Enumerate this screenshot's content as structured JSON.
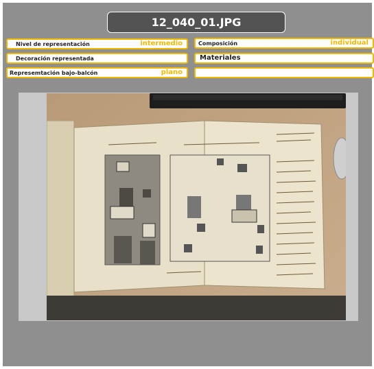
{
  "header": {
    "title": "12_040_01.JPG"
  },
  "fields": {
    "nivel_label": "Nivel de representación",
    "nivel_value": "intermedio",
    "composicion_label": "Composición",
    "composicion_value": "individual",
    "decoracion_label": "Decoración representada",
    "materiales_label": "Materiales",
    "bajo_balcon_label": "Represemtación bajo-balcón",
    "bajo_balcon_value": "plano"
  },
  "colors": {
    "panel": "#8f8f8f",
    "field_border": "#f0b800",
    "value_text": "#f5b800",
    "title_bg": "#535353"
  }
}
